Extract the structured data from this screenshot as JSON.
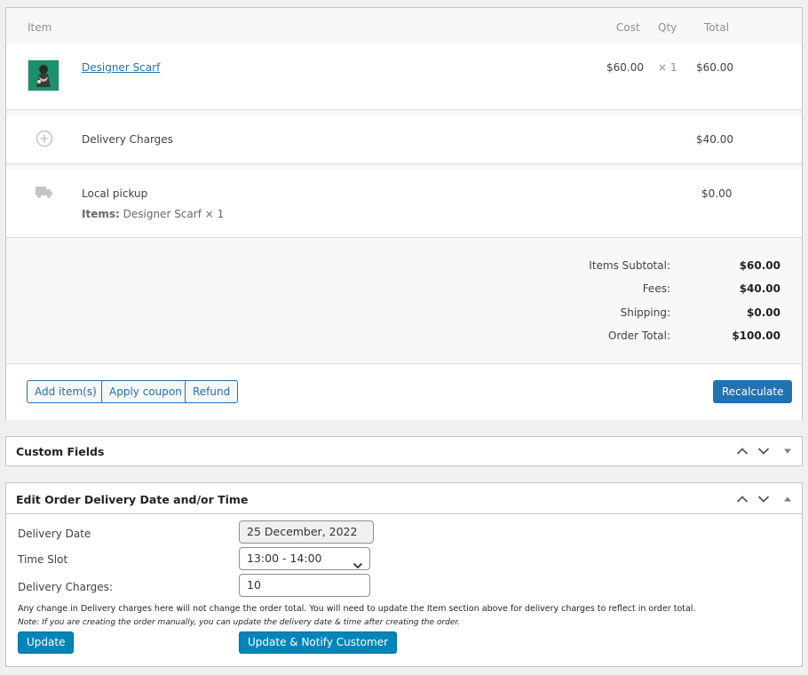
{
  "items_table": {
    "headers": {
      "item": "Item",
      "cost": "Cost",
      "qty": "Qty",
      "total": "Total"
    },
    "product": {
      "name": "Designer Scarf",
      "cost": "$60.00",
      "qty": "× 1",
      "total": "$60.00"
    },
    "fee": {
      "name": "Delivery Charges",
      "total": "$40.00"
    },
    "shipping": {
      "name": "Local pickup",
      "items_label": "Items:",
      "items_value": "Designer Scarf × 1",
      "total": "$0.00"
    }
  },
  "totals": {
    "subtotal_label": "Items Subtotal:",
    "subtotal_value": "$60.00",
    "fees_label": "Fees:",
    "fees_value": "$40.00",
    "shipping_label": "Shipping:",
    "shipping_value": "$0.00",
    "order_total_label": "Order Total:",
    "order_total_value": "$100.00"
  },
  "actions": {
    "add_items": "Add item(s)",
    "apply_coupon": "Apply coupon",
    "refund": "Refund",
    "recalculate": "Recalculate"
  },
  "custom_fields": {
    "title": "Custom Fields"
  },
  "delivery_box": {
    "title": "Edit Order Delivery Date and/or Time",
    "date_label": "Delivery Date",
    "date_value": "25 December, 2022",
    "slot_label": "Time Slot",
    "slot_value": "13:00 - 14:00",
    "charges_label": "Delivery Charges:",
    "charges_value": "10",
    "notice": "Any change in Delivery charges here will not change the order total. You will need to update the Item section above for delivery charges to reflect in order total.",
    "note": "Note: If you are creating the order manually, you can update the delivery date & time after creating the order.",
    "update_btn": "Update",
    "notify_btn": "Update & Notify Customer"
  },
  "colors": {
    "accent": "#2271b1",
    "notify_blue": "#0085ba",
    "thumb_green": "#1d8f6c"
  }
}
